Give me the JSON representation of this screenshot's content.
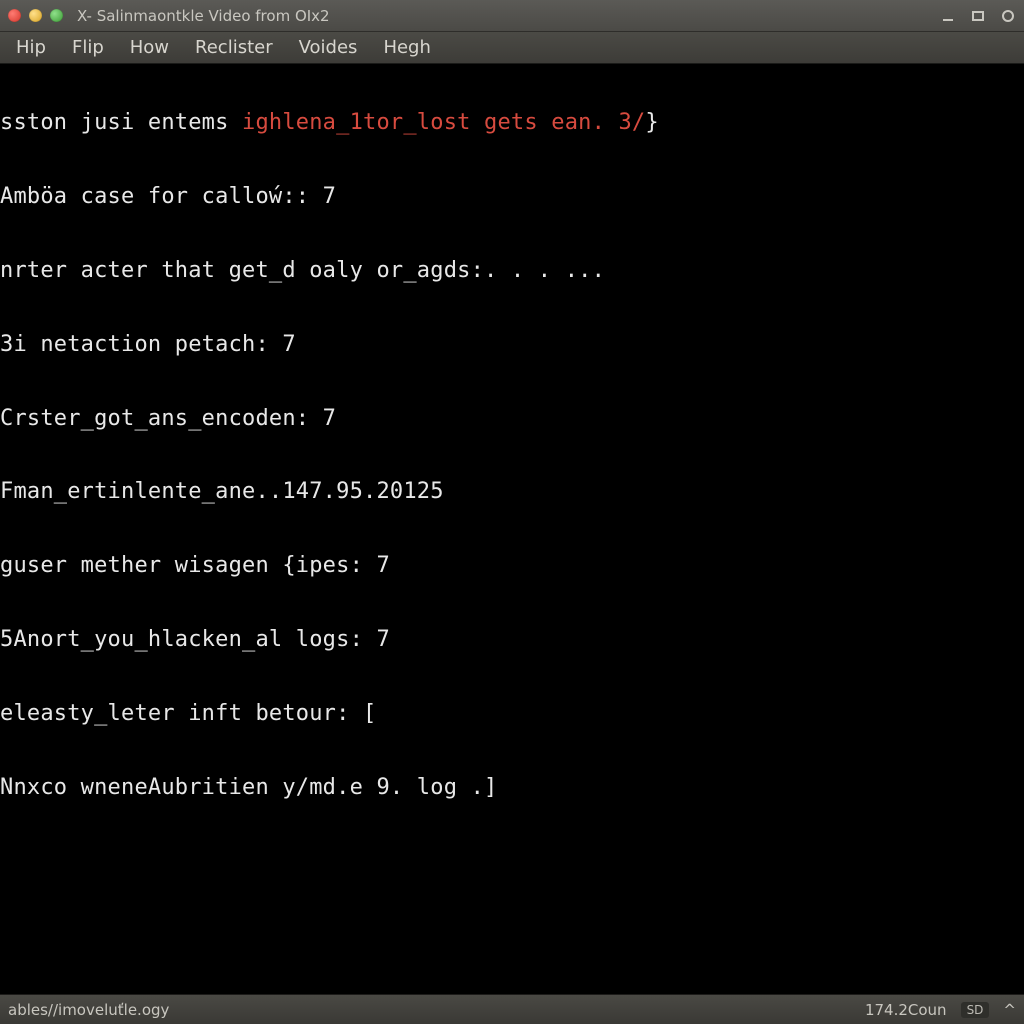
{
  "window": {
    "title": "X- Salinmaontkle Video from OIx2"
  },
  "menu": {
    "items": [
      {
        "label": "Hip"
      },
      {
        "label": "Flip"
      },
      {
        "label": "How"
      },
      {
        "label": "Reclister"
      },
      {
        "label": "Voides"
      },
      {
        "label": "Hegh"
      }
    ]
  },
  "terminal": {
    "lines": [
      {
        "pre": "sston jusi entems ",
        "hl": "ighlena_1tor_lost gets ean. 3/",
        "post": "}"
      },
      {
        "pre": "Amböa case for calloẃ:: 7"
      },
      {
        "pre": "nrter acter that get_d oaly or_agds:. . . ..."
      },
      {
        "pre": "3i netaction petach: 7"
      },
      {
        "pre": "Crster_got_ans_encoden: 7"
      },
      {
        "pre": "Fman_ertinlente_ane..147.95.20125"
      },
      {
        "pre": "guser mether wisagen {ipes: 7"
      },
      {
        "pre": "5Anort_you_hlacken_al logs: 7"
      },
      {
        "pre": "eleasty_leter inft betour: ["
      },
      {
        "pre": "Nnxco wneneAubritien y/md.e 9. log .]"
      }
    ]
  },
  "status": {
    "left": "ables//imoveluťle.ogy",
    "right_value": "174.2Coun",
    "chip": "SD"
  }
}
